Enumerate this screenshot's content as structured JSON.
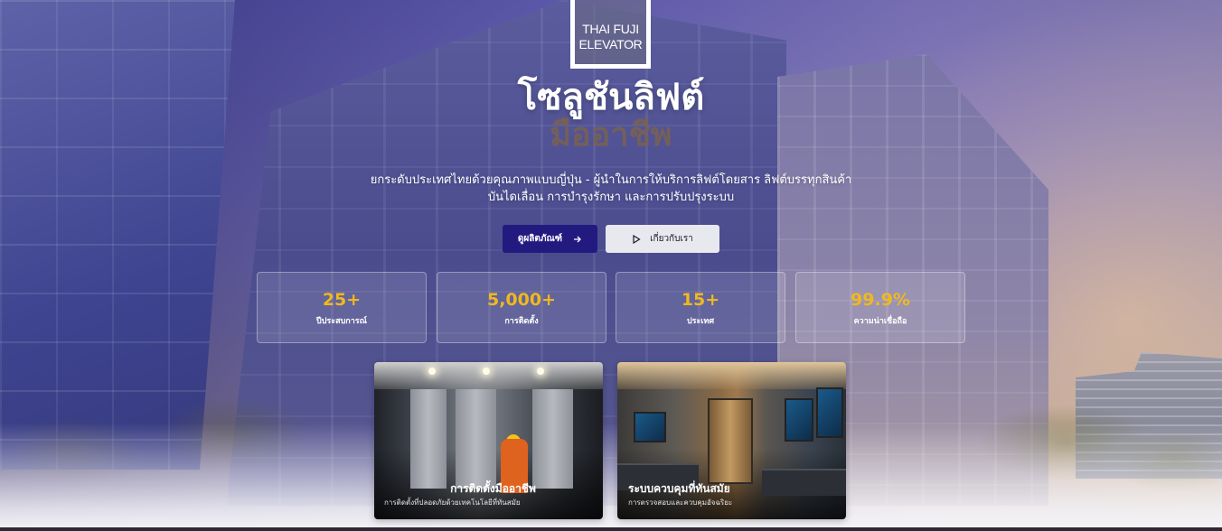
{
  "brand": {
    "logo_line1": "THAI FUJI",
    "logo_line2": "ELEVATOR"
  },
  "hero": {
    "title_line1": "โซลูชันลิฟต์",
    "title_line2": "มืออาชีพ",
    "subtitle_line1": "ยกระดับประเทศไทยด้วยคุณภาพแบบญี่ปุ่น - ผู้นำในการให้บริการลิฟต์โดยสาร ลิฟต์บรรทุกสินค้า",
    "subtitle_line2": "บันไดเลื่อน การบำรุงรักษา และการปรับปรุงระบบ"
  },
  "buttons": {
    "primary_label": "ดูผลิตภัณฑ์",
    "primary_icon": "arrow-right-icon",
    "secondary_label": "เกี่ยวกับเรา",
    "secondary_icon": "play-icon"
  },
  "stats": [
    {
      "value": "25+",
      "label": "ปีประสบการณ์"
    },
    {
      "value": "5,000+",
      "label": "การติดตั้ง"
    },
    {
      "value": "15+",
      "label": "ประเทศ"
    },
    {
      "value": "99.9%",
      "label": "ความน่าเชื่อถือ"
    }
  ],
  "cards": [
    {
      "title": "การติดตั้งมืออาชีพ",
      "description": "การติดตั้งที่ปลอดภัยด้วยเทคโนโลยีที่ทันสมัย"
    },
    {
      "title": "ระบบควบคุมที่ทันสมัย",
      "description": "การตรวจสอบและควบคุมอัจฉริยะ"
    }
  ],
  "colors": {
    "accent_gold": "#f0b81f",
    "primary_button": "#231a80",
    "title_secondary": "#7a6250"
  }
}
